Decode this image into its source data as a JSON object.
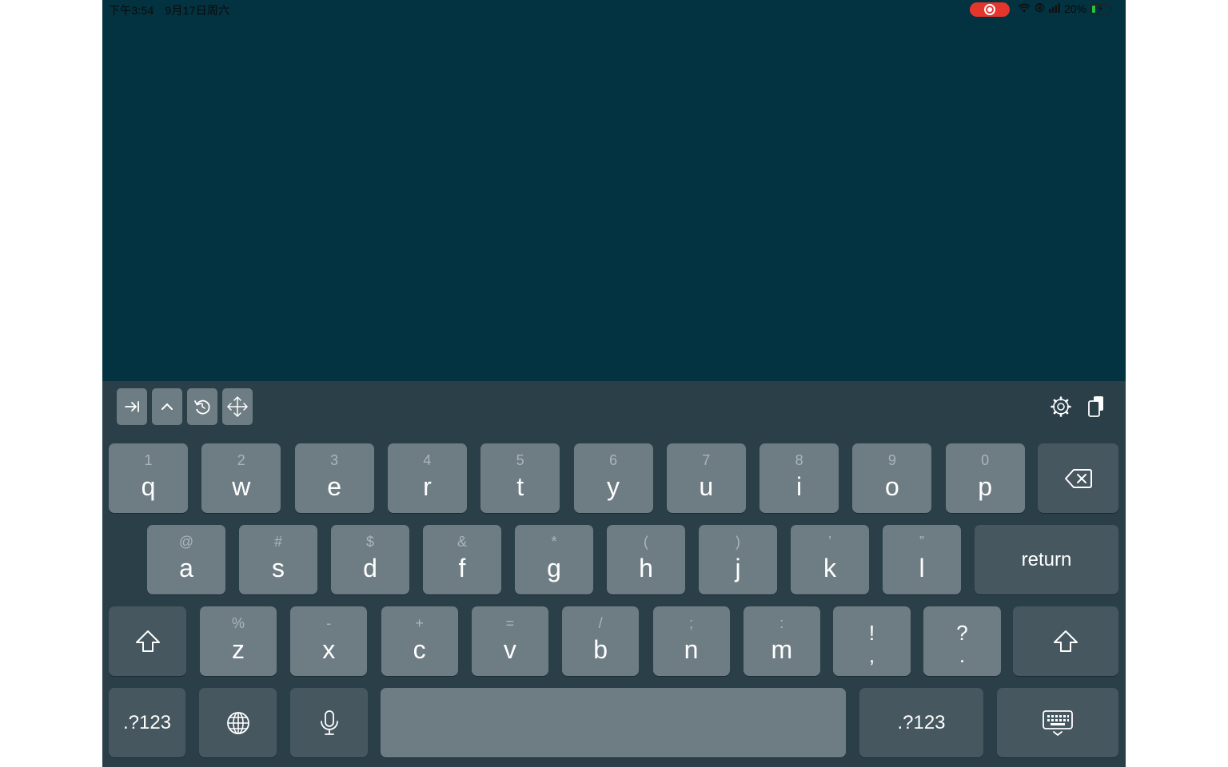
{
  "status_bar": {
    "time": "下午3:54",
    "date": "9月17日周六",
    "battery": "20%",
    "battery_level": 0.2,
    "recording_color": "#e5362e"
  },
  "colors": {
    "app_background": "#033240",
    "keyboard_background": "#2b3f49",
    "key_light": "#6e7d84",
    "key_dark": "#46575f"
  },
  "toolbar": {
    "left_icons": [
      "tab-icon",
      "chevron-up-icon",
      "undo-history-icon",
      "move-arrows-icon"
    ],
    "right_icons": [
      "settings-gear-icon",
      "clipboard-icon"
    ]
  },
  "keyboard": {
    "row1": [
      {
        "hint": "1",
        "key": "q"
      },
      {
        "hint": "2",
        "key": "w"
      },
      {
        "hint": "3",
        "key": "e"
      },
      {
        "hint": "4",
        "key": "r"
      },
      {
        "hint": "5",
        "key": "t"
      },
      {
        "hint": "6",
        "key": "y"
      },
      {
        "hint": "7",
        "key": "u"
      },
      {
        "hint": "8",
        "key": "i"
      },
      {
        "hint": "9",
        "key": "o"
      },
      {
        "hint": "0",
        "key": "p"
      }
    ],
    "row2": [
      {
        "hint": "@",
        "key": "a"
      },
      {
        "hint": "#",
        "key": "s"
      },
      {
        "hint": "$",
        "key": "d"
      },
      {
        "hint": "&",
        "key": "f"
      },
      {
        "hint": "*",
        "key": "g"
      },
      {
        "hint": "(",
        "key": "h"
      },
      {
        "hint": ")",
        "key": "j"
      },
      {
        "hint": "’",
        "key": "k"
      },
      {
        "hint": "”",
        "key": "l"
      }
    ],
    "return_label": "return",
    "row3": [
      {
        "hint": "%",
        "key": "z"
      },
      {
        "hint": "-",
        "key": "x"
      },
      {
        "hint": "+",
        "key": "c"
      },
      {
        "hint": "=",
        "key": "v"
      },
      {
        "hint": "/",
        "key": "b"
      },
      {
        "hint": ";",
        "key": "n"
      },
      {
        "hint": ":",
        "key": "m"
      }
    ],
    "punct": [
      {
        "top": "!",
        "bottom": ","
      },
      {
        "top": "?",
        "bottom": "."
      }
    ],
    "numbers_label_left": ".?123",
    "numbers_label_right": ".?123"
  }
}
